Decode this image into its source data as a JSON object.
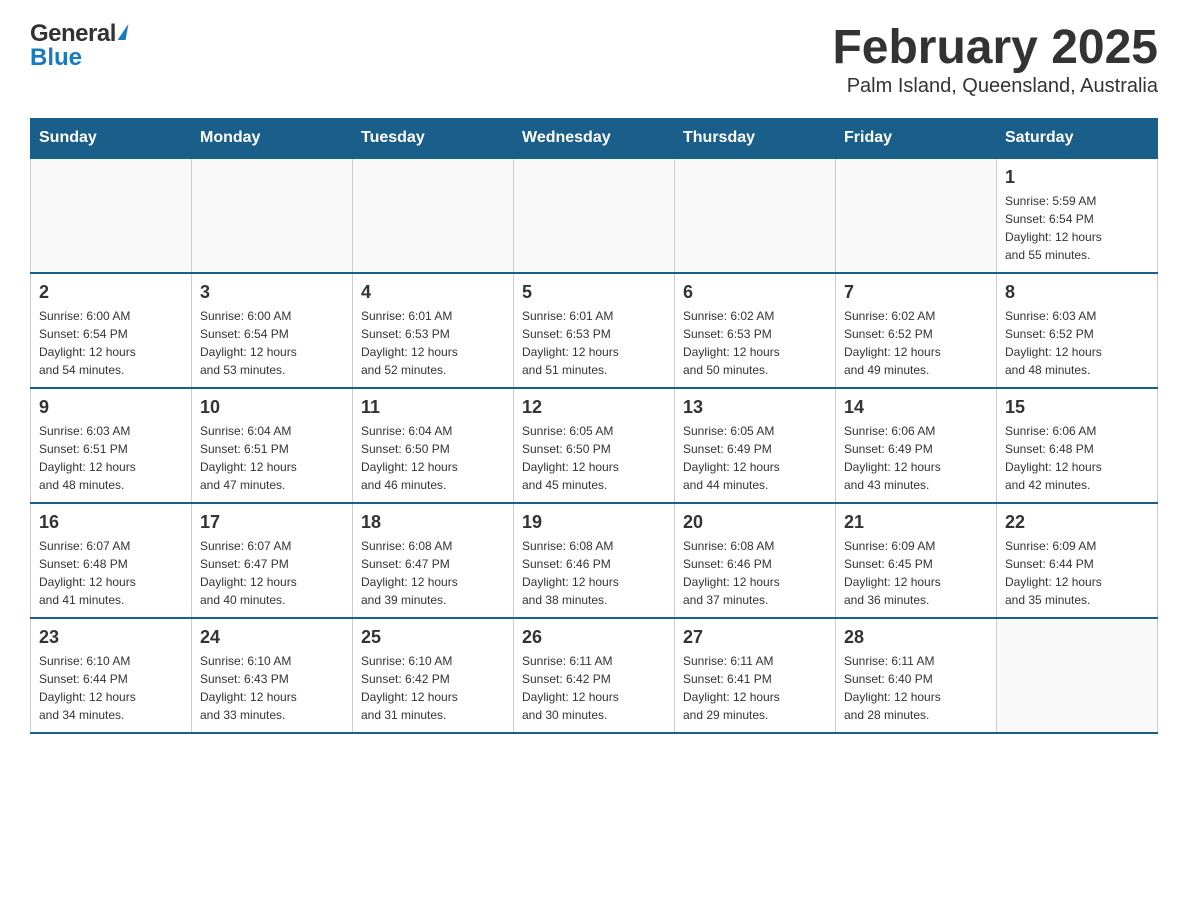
{
  "header": {
    "logo_general": "General",
    "logo_blue": "Blue",
    "month_title": "February 2025",
    "location": "Palm Island, Queensland, Australia"
  },
  "days_of_week": [
    "Sunday",
    "Monday",
    "Tuesday",
    "Wednesday",
    "Thursday",
    "Friday",
    "Saturday"
  ],
  "weeks": [
    [
      {
        "day": "",
        "info": ""
      },
      {
        "day": "",
        "info": ""
      },
      {
        "day": "",
        "info": ""
      },
      {
        "day": "",
        "info": ""
      },
      {
        "day": "",
        "info": ""
      },
      {
        "day": "",
        "info": ""
      },
      {
        "day": "1",
        "info": "Sunrise: 5:59 AM\nSunset: 6:54 PM\nDaylight: 12 hours\nand 55 minutes."
      }
    ],
    [
      {
        "day": "2",
        "info": "Sunrise: 6:00 AM\nSunset: 6:54 PM\nDaylight: 12 hours\nand 54 minutes."
      },
      {
        "day": "3",
        "info": "Sunrise: 6:00 AM\nSunset: 6:54 PM\nDaylight: 12 hours\nand 53 minutes."
      },
      {
        "day": "4",
        "info": "Sunrise: 6:01 AM\nSunset: 6:53 PM\nDaylight: 12 hours\nand 52 minutes."
      },
      {
        "day": "5",
        "info": "Sunrise: 6:01 AM\nSunset: 6:53 PM\nDaylight: 12 hours\nand 51 minutes."
      },
      {
        "day": "6",
        "info": "Sunrise: 6:02 AM\nSunset: 6:53 PM\nDaylight: 12 hours\nand 50 minutes."
      },
      {
        "day": "7",
        "info": "Sunrise: 6:02 AM\nSunset: 6:52 PM\nDaylight: 12 hours\nand 49 minutes."
      },
      {
        "day": "8",
        "info": "Sunrise: 6:03 AM\nSunset: 6:52 PM\nDaylight: 12 hours\nand 48 minutes."
      }
    ],
    [
      {
        "day": "9",
        "info": "Sunrise: 6:03 AM\nSunset: 6:51 PM\nDaylight: 12 hours\nand 48 minutes."
      },
      {
        "day": "10",
        "info": "Sunrise: 6:04 AM\nSunset: 6:51 PM\nDaylight: 12 hours\nand 47 minutes."
      },
      {
        "day": "11",
        "info": "Sunrise: 6:04 AM\nSunset: 6:50 PM\nDaylight: 12 hours\nand 46 minutes."
      },
      {
        "day": "12",
        "info": "Sunrise: 6:05 AM\nSunset: 6:50 PM\nDaylight: 12 hours\nand 45 minutes."
      },
      {
        "day": "13",
        "info": "Sunrise: 6:05 AM\nSunset: 6:49 PM\nDaylight: 12 hours\nand 44 minutes."
      },
      {
        "day": "14",
        "info": "Sunrise: 6:06 AM\nSunset: 6:49 PM\nDaylight: 12 hours\nand 43 minutes."
      },
      {
        "day": "15",
        "info": "Sunrise: 6:06 AM\nSunset: 6:48 PM\nDaylight: 12 hours\nand 42 minutes."
      }
    ],
    [
      {
        "day": "16",
        "info": "Sunrise: 6:07 AM\nSunset: 6:48 PM\nDaylight: 12 hours\nand 41 minutes."
      },
      {
        "day": "17",
        "info": "Sunrise: 6:07 AM\nSunset: 6:47 PM\nDaylight: 12 hours\nand 40 minutes."
      },
      {
        "day": "18",
        "info": "Sunrise: 6:08 AM\nSunset: 6:47 PM\nDaylight: 12 hours\nand 39 minutes."
      },
      {
        "day": "19",
        "info": "Sunrise: 6:08 AM\nSunset: 6:46 PM\nDaylight: 12 hours\nand 38 minutes."
      },
      {
        "day": "20",
        "info": "Sunrise: 6:08 AM\nSunset: 6:46 PM\nDaylight: 12 hours\nand 37 minutes."
      },
      {
        "day": "21",
        "info": "Sunrise: 6:09 AM\nSunset: 6:45 PM\nDaylight: 12 hours\nand 36 minutes."
      },
      {
        "day": "22",
        "info": "Sunrise: 6:09 AM\nSunset: 6:44 PM\nDaylight: 12 hours\nand 35 minutes."
      }
    ],
    [
      {
        "day": "23",
        "info": "Sunrise: 6:10 AM\nSunset: 6:44 PM\nDaylight: 12 hours\nand 34 minutes."
      },
      {
        "day": "24",
        "info": "Sunrise: 6:10 AM\nSunset: 6:43 PM\nDaylight: 12 hours\nand 33 minutes."
      },
      {
        "day": "25",
        "info": "Sunrise: 6:10 AM\nSunset: 6:42 PM\nDaylight: 12 hours\nand 31 minutes."
      },
      {
        "day": "26",
        "info": "Sunrise: 6:11 AM\nSunset: 6:42 PM\nDaylight: 12 hours\nand 30 minutes."
      },
      {
        "day": "27",
        "info": "Sunrise: 6:11 AM\nSunset: 6:41 PM\nDaylight: 12 hours\nand 29 minutes."
      },
      {
        "day": "28",
        "info": "Sunrise: 6:11 AM\nSunset: 6:40 PM\nDaylight: 12 hours\nand 28 minutes."
      },
      {
        "day": "",
        "info": ""
      }
    ]
  ]
}
